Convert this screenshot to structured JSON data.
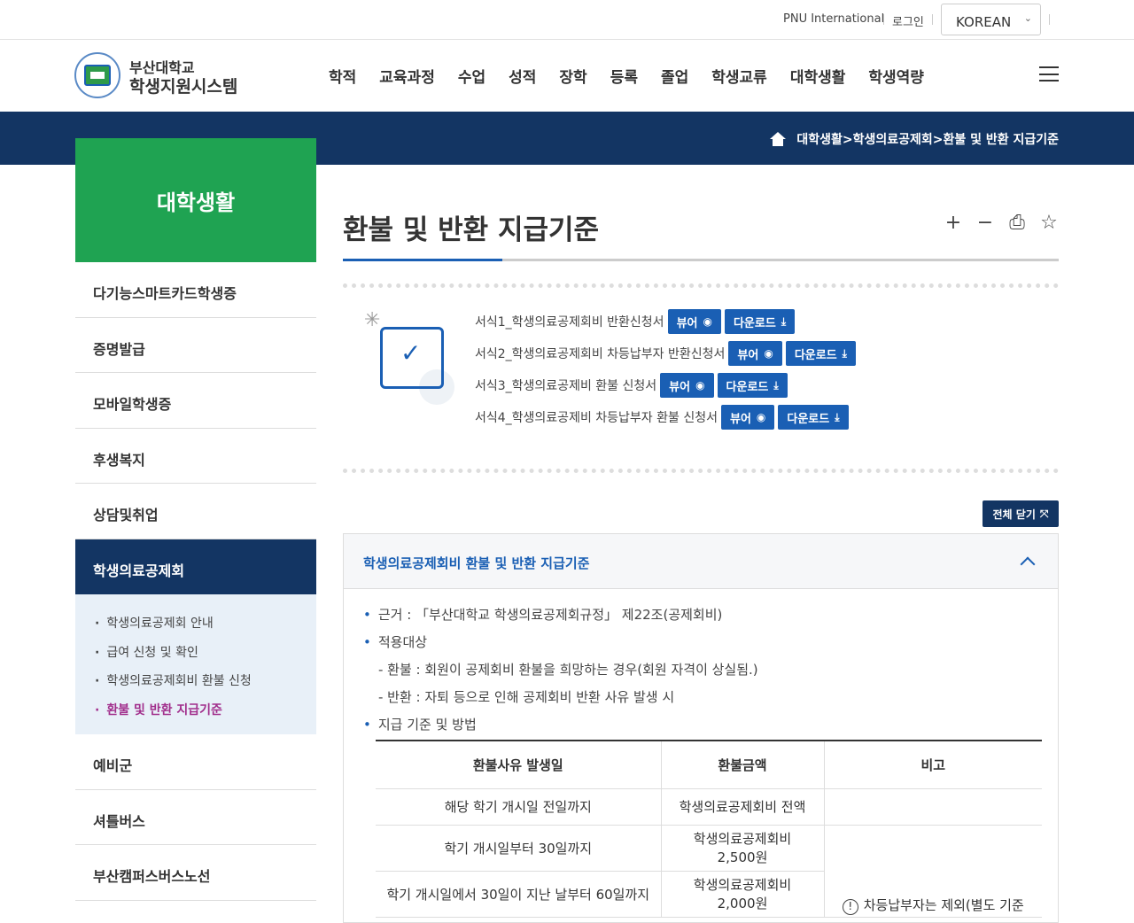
{
  "topbar": {
    "intl": "PNU International",
    "login": "로그인",
    "language": "KOREAN"
  },
  "brand": {
    "line1": "부산대학교",
    "line2": "학생지원시스템"
  },
  "gnb": [
    "학적",
    "교육과정",
    "수업",
    "성적",
    "장학",
    "등록",
    "졸업",
    "학생교류",
    "대학생활",
    "학생역량"
  ],
  "breadcrumb": "대학생활>학생의료공제회>환불 및 반환 지급기준",
  "sidebar": {
    "title": "대학생활",
    "items_before": [
      "다기능스마트카드학생증",
      "증명발급",
      "모바일학생증",
      "후생복지",
      "상담및취업"
    ],
    "active": "학생의료공제회",
    "sub": [
      "학생의료공제회 안내",
      "급여 신청 및 확인",
      "학생의료공제회비 환불 신청",
      "환불 및 반환 지급기준"
    ],
    "items_after": [
      "예비군",
      "셔틀버스",
      "부산캠퍼스버스노선"
    ]
  },
  "page": {
    "title": "환불 및 반환 지급기준"
  },
  "forms": [
    {
      "name": "서식1_학생의료공제회비 반환신청서"
    },
    {
      "name": "서식2_학생의료공제회비 차등납부자 반환신청서"
    },
    {
      "name": "서식3_학생의료공제비 환불 신청서"
    },
    {
      "name": "서식4_학생의료공제비 차등납부자 환불 신청서"
    }
  ],
  "buttons": {
    "viewer": "뷰어",
    "download": "다운로드",
    "close_all": "전체 닫기"
  },
  "accordion": {
    "title": "학생의료공제회비 환불 및 반환 지급기준",
    "basis": "근거 : 「부산대학교 학생의료공제회규정」 제22조(공제회비)",
    "target": "적용대상",
    "refund": "- 환불 : 회원이 공제회비 환불을 희망하는 경우(회원 자격이 상실됨.)",
    "return": "- 반환 : 자퇴 등으로 인해 공제회비 반환 사유 발생 시",
    "criteria": "지급 기준 및 방법"
  },
  "table": {
    "headers": [
      "환불사유 발생일",
      "환불금액",
      "비고"
    ],
    "rows": [
      {
        "reason": "해당 학기 개시일 전일까지",
        "amount": "학생의료공제회비 전액"
      },
      {
        "reason": "학기 개시일부터 30일까지",
        "amount": "학생의료공제회비 2,500원"
      },
      {
        "reason": "학기 개시일에서 30일이 지난 날부터 60일까지",
        "amount": "학생의료공제회비 2,000원"
      }
    ],
    "note": "차등납부자는 제외(별도 기준"
  },
  "icons": {
    "tools": [
      "plus-icon",
      "minus-icon",
      "print-icon",
      "star-icon"
    ]
  }
}
